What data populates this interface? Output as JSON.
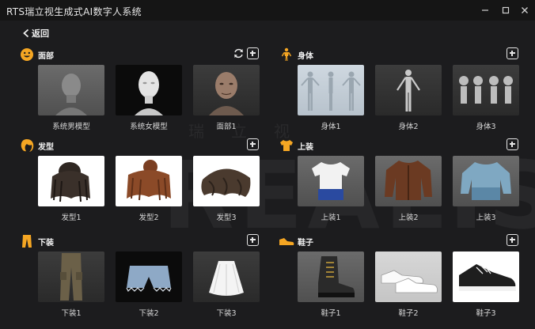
{
  "window": {
    "title": "RTS瑞立视生成式AI数字人系统"
  },
  "nav": {
    "back_label": "返回"
  },
  "watermark": {
    "text": "REALIS",
    "subtext": "瑞立视"
  },
  "sections": {
    "face": {
      "title": "面部",
      "icon": "smiley-face-icon",
      "items": [
        "系统男模型",
        "系统女模型",
        "面部1"
      ]
    },
    "body": {
      "title": "身体",
      "icon": "person-figure-icon",
      "items": [
        "身体1",
        "身体2",
        "身体3"
      ]
    },
    "hair": {
      "title": "发型",
      "icon": "hair-icon",
      "items": [
        "发型1",
        "发型2",
        "发型3"
      ]
    },
    "top": {
      "title": "上装",
      "icon": "tshirt-icon",
      "items": [
        "上装1",
        "上装2",
        "上装3"
      ]
    },
    "bottom": {
      "title": "下装",
      "icon": "pants-icon",
      "items": [
        "下装1",
        "下装2",
        "下装3"
      ]
    },
    "shoes": {
      "title": "鞋子",
      "icon": "shoe-icon",
      "items": [
        "鞋子1",
        "鞋子2",
        "鞋子3"
      ]
    }
  },
  "colors": {
    "accent": "#f5a623",
    "background": "#1c1c1e",
    "titlebar": "#151515"
  }
}
